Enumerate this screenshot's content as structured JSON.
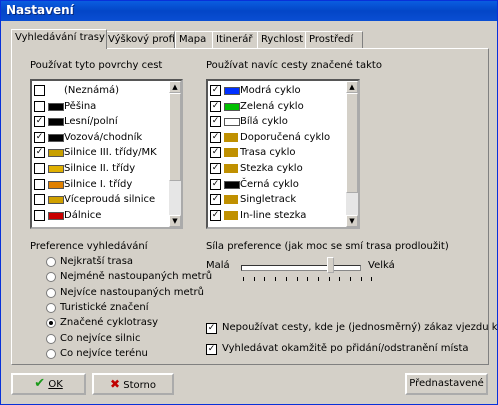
{
  "window": {
    "title": "Nastavení"
  },
  "tabs": [
    "Vyhledávání trasy",
    "Výškový profil",
    "Mapa",
    "Itinerář",
    "Rychlost",
    "Prostředí"
  ],
  "surfaces": {
    "label": "Používat tyto povrchy cest",
    "items": [
      {
        "label": "(Neznámá)",
        "checked": false,
        "color": "none"
      },
      {
        "label": "Pěšina",
        "checked": false,
        "color": "#000000"
      },
      {
        "label": "Lesní/polní",
        "checked": true,
        "color": "#000000"
      },
      {
        "label": "Vozová/chodník",
        "checked": true,
        "color": "#000000"
      },
      {
        "label": "Silnice III. třídy/MK",
        "checked": true,
        "color": "#c8a000"
      },
      {
        "label": "Silnice II. třídy",
        "checked": false,
        "color": "#e0b000"
      },
      {
        "label": "Silnice I. třídy",
        "checked": false,
        "color": "#e08000"
      },
      {
        "label": "Víceproudá silnice",
        "checked": false,
        "color": "#d0a000"
      },
      {
        "label": "Dálnice",
        "checked": false,
        "color": "#c80000"
      }
    ]
  },
  "marked": {
    "label": "Používat navíc cesty značené takto",
    "items": [
      {
        "label": "Modrá cyklo",
        "checked": true,
        "color": "#0030ff"
      },
      {
        "label": "Zelená cyklo",
        "checked": true,
        "color": "#00c000"
      },
      {
        "label": "Bílá cyklo",
        "checked": true,
        "color": "#ffffff"
      },
      {
        "label": "Doporučená cyklo",
        "checked": true,
        "color": "icon"
      },
      {
        "label": "Trasa cyklo",
        "checked": true,
        "color": "icon"
      },
      {
        "label": "Stezka cyklo",
        "checked": true,
        "color": "icon"
      },
      {
        "label": "Černá cyklo",
        "checked": true,
        "color": "#000000"
      },
      {
        "label": "Singletrack",
        "checked": true,
        "color": "icon"
      },
      {
        "label": "In-line stezka",
        "checked": true,
        "color": "icon"
      }
    ]
  },
  "preference": {
    "label": "Preference vyhledávání",
    "options": [
      "Nejkratší trasa",
      "Nejméně nastoupaných metrů",
      "Nejvíce nastoupaných metrů",
      "Turistické značení",
      "Značené cyklotrasy",
      "Co nejvíce silnic",
      "Co nejvíce terénu"
    ],
    "selected_index": 4
  },
  "strength": {
    "label": "Síla preference (jak moc se smí trasa prodloužit)",
    "min_label": "Malá",
    "max_label": "Velká",
    "value_fraction": 0.76
  },
  "options": {
    "no_oneway": "Nepoužívat cesty, kde je (jednosměrný) zákaz vjezdu kol",
    "instant": "Vyhledávat okamžitě po přidání/odstranění místa"
  },
  "buttons": {
    "ok": "OK",
    "cancel": "Storno",
    "preset": "Přednastavené"
  }
}
